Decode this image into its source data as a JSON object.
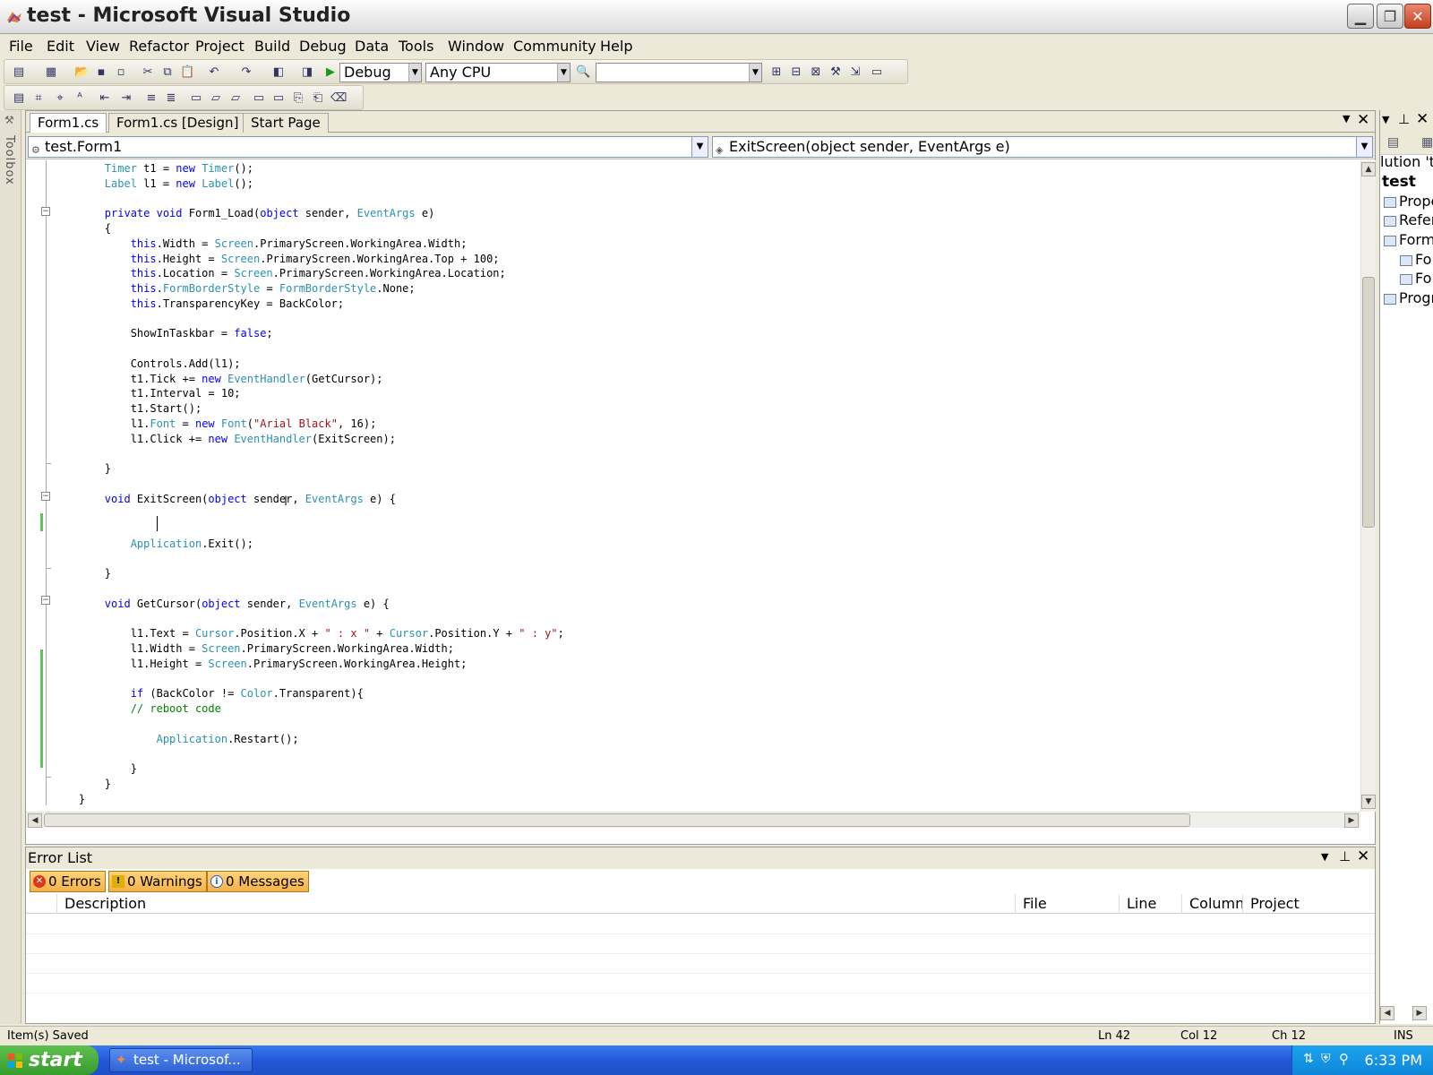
{
  "window": {
    "title": "test - Microsoft Visual Studio"
  },
  "menu": [
    "File",
    "Edit",
    "View",
    "Refactor",
    "Project",
    "Build",
    "Debug",
    "Data",
    "Tools",
    "Window",
    "Community",
    "Help"
  ],
  "toolbar": {
    "config": "Debug",
    "platform": "Any CPU",
    "find": ""
  },
  "toolbox": {
    "label": "Toolbox"
  },
  "tabs": [
    "Form1.cs",
    "Form1.cs [Design]",
    "Start Page"
  ],
  "nav": {
    "class": "test.Form1",
    "member": "ExitScreen(object sender, EventArgs e)"
  },
  "code": [
    "        Timer t1 = new Timer();",
    "        Label l1 = new Label();",
    "",
    "        private void Form1_Load(object sender, EventArgs e)",
    "        {",
    "            this.Width = Screen.PrimaryScreen.WorkingArea.Width;",
    "            this.Height = Screen.PrimaryScreen.WorkingArea.Top + 100;",
    "            this.Location = Screen.PrimaryScreen.WorkingArea.Location;",
    "            this.FormBorderStyle = FormBorderStyle.None;",
    "            this.TransparencyKey = BackColor;",
    "",
    "            ShowInTaskbar = false;",
    "",
    "            Controls.Add(l1);",
    "            t1.Tick += new EventHandler(GetCursor);",
    "            t1.Interval = 10;",
    "            t1.Start();",
    "            l1.Font = new Font(\"Arial Black\", 16);",
    "            l1.Click += new EventHandler(ExitScreen);",
    "",
    "        }",
    "",
    "        void ExitScreen(object sender, EventArgs e) {",
    "",
    "",
    "            Application.Exit();",
    "",
    "        }",
    "",
    "        void GetCursor(object sender, EventArgs e) {",
    "",
    "            l1.Text = Cursor.Position.X + \" : x \" + Cursor.Position.Y + \" : y\";",
    "            l1.Width = Screen.PrimaryScreen.WorkingArea.Width;",
    "            l1.Height = Screen.PrimaryScreen.WorkingArea.Height;",
    "",
    "            if (BackColor != Color.Transparent){",
    "            // reboot code",
    "",
    "                Application.Restart();",
    "",
    "            }",
    "        }",
    "    }"
  ],
  "errorList": {
    "title": "Error List",
    "filters": {
      "errors": "0 Errors",
      "warnings": "0 Warnings",
      "messages": "0 Messages"
    },
    "columns": {
      "description": "Description",
      "file": "File",
      "line": "Line",
      "column": "Column",
      "project": "Project"
    }
  },
  "solution": {
    "root": "lution 'te",
    "project": "test",
    "items": [
      "Prope",
      "Refer",
      "Form",
      "Fo",
      "Fo",
      "Progr"
    ]
  },
  "status": {
    "message": "Item(s) Saved",
    "ln": "Ln 42",
    "col": "Col 12",
    "ch": "Ch 12",
    "mode": "INS"
  },
  "taskbar": {
    "start": "start",
    "task": "test - Microsof...",
    "clock": "6:33 PM"
  }
}
